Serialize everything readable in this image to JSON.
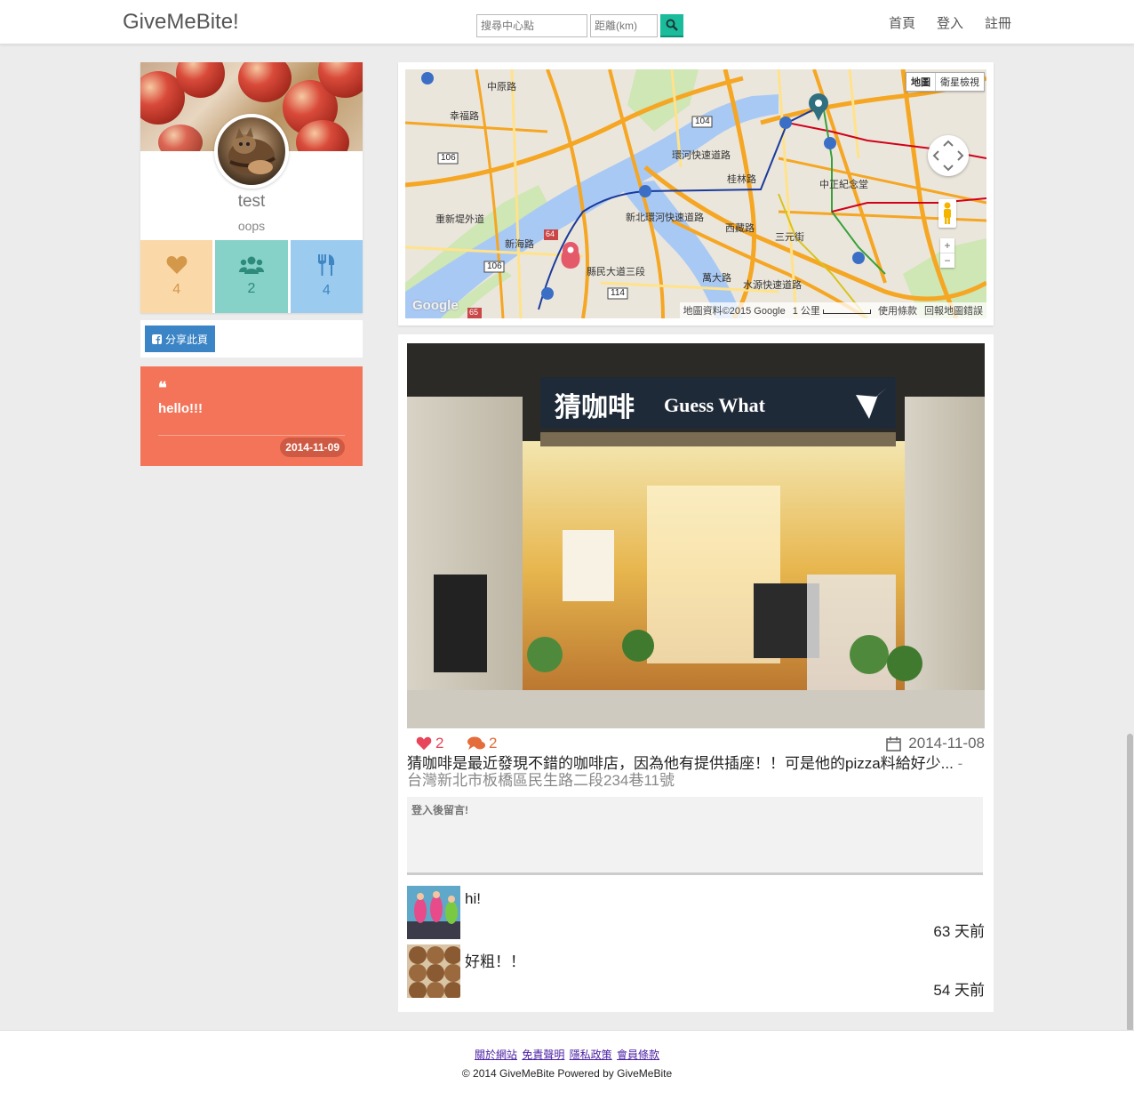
{
  "navbar": {
    "brand": "GiveMeBite!",
    "search_center_placeholder": "搜尋中心點",
    "search_distance_placeholder": "距離(km)",
    "links": [
      "首頁",
      "登入",
      "註冊"
    ]
  },
  "profile": {
    "name": "test",
    "bio": "oops",
    "stats": {
      "likes": "4",
      "friends": "2",
      "posts": "4"
    },
    "share_label": "分享此頁"
  },
  "quote": {
    "text": "hello!!!",
    "date": "2014-11-09"
  },
  "map": {
    "type_map": "地圖",
    "type_satellite": "衛星檢視",
    "attribution": "地圖資料©2015 Google",
    "scale": "1 公里",
    "terms": "使用條款",
    "report": "回報地圖錯誤",
    "logo": "Google",
    "labels": [
      "中原路",
      "幸福路",
      "中正紀念堂",
      "桂林路",
      "西藏路",
      "三元街",
      "縣民大道三段",
      "新海路",
      "萬大路",
      "水源快速道路",
      "環河快速道路",
      "新北環河快速道路",
      "重新堤外道"
    ],
    "shields": [
      "104",
      "106",
      "106",
      "114",
      "64",
      "65"
    ]
  },
  "post": {
    "photo_sign_cn": "猜咖啡",
    "photo_sign_en": "Guess What",
    "likes": "2",
    "comments": "2",
    "date": "2014-11-08",
    "description": "猜咖啡是最近發現不錯的咖啡店，因為他有提供插座！！可是他的pizza料給好少...",
    "address": "- 台灣新北市板橋區民生路二段234巷11號",
    "comment_placeholder": "登入後留言!",
    "comment_list": [
      {
        "text": "hi!",
        "time": "63 天前"
      },
      {
        "text": "好粗！！",
        "time": "54 天前"
      }
    ]
  },
  "footer": {
    "links": [
      "關於網站",
      "免責聲明",
      "隱私政策",
      "會員條款"
    ],
    "copyright": "© 2014 GiveMeBite Powered by GiveMeBite"
  },
  "colors": {
    "accent": "#1abc9c",
    "likes_tile": "#fad8a8",
    "friends_tile": "#86d2c8",
    "posts_tile": "#9ccbf0",
    "quote_bg": "#f37458",
    "share_btn": "#3b85c6"
  }
}
